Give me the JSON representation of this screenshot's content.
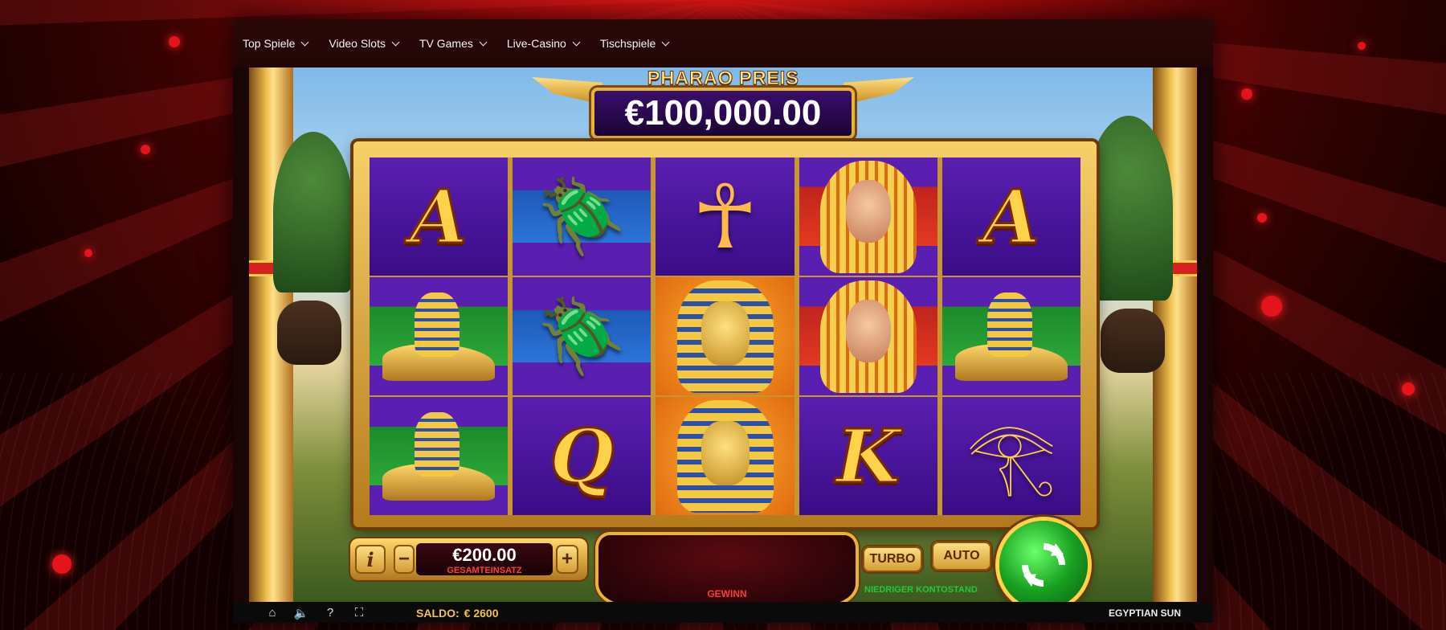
{
  "nav": {
    "items": [
      {
        "label": "Top Spiele"
      },
      {
        "label": "Video Slots"
      },
      {
        "label": "TV Games"
      },
      {
        "label": "Live-Casino"
      },
      {
        "label": "Tischspiele"
      }
    ]
  },
  "jackpot": {
    "title": "PHARAO PREIS",
    "value": "€100,000.00"
  },
  "reels": [
    [
      "A",
      "sphinx",
      "sphinx"
    ],
    [
      "scarab",
      "scarab",
      "Q"
    ],
    [
      "ankh",
      "pharaoh",
      "pharaoh"
    ],
    [
      "queen",
      "queen",
      "K"
    ],
    [
      "A",
      "sphinx",
      "eye-of-horus"
    ]
  ],
  "controls": {
    "info_label": "i",
    "minus_label": "−",
    "plus_label": "+",
    "bet_value": "€200.00",
    "bet_label": "GESAMTEINSATZ",
    "win_label": "GEWINN",
    "turbo_label": "TURBO",
    "auto_label": "AUTO",
    "low_balance": "NIEDRIGER KONTOSTAND"
  },
  "statusbar": {
    "icons": [
      "home-icon",
      "sound-icon",
      "help-icon",
      "fullscreen-icon"
    ],
    "saldo_label": "SALDO:",
    "saldo_value": "€ 2600",
    "game_name": "EGYPTIAN SUN"
  },
  "colors": {
    "background_red": "#a00a0a",
    "gold": "#e7b43a",
    "reel_purple": "#4a149a",
    "spin_green": "#18a020",
    "win_red": "#ff3838",
    "low_balance_green": "#22c83a"
  }
}
